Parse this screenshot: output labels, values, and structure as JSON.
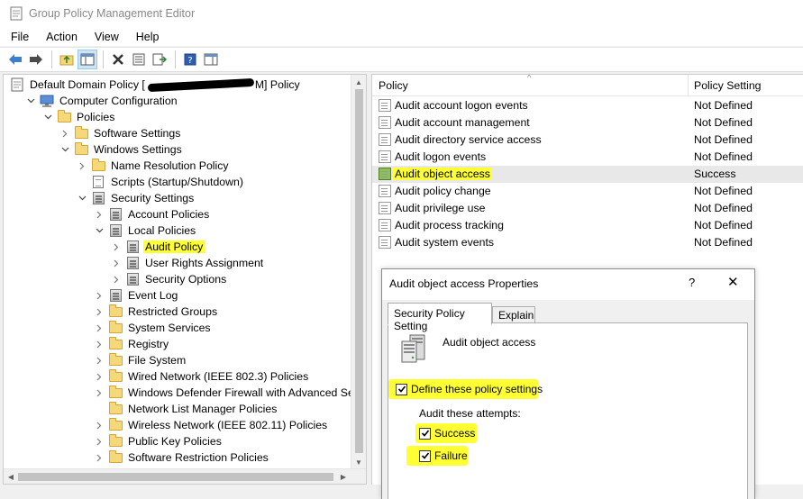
{
  "window": {
    "title": "Group Policy Management Editor"
  },
  "menu": [
    "File",
    "Action",
    "View",
    "Help"
  ],
  "tree": [
    {
      "label": "Default Domain Policy [",
      "suffix": "M] Policy",
      "indent": 0,
      "icon": "gpo-doc-icon",
      "arrow": "none",
      "highlight": false
    },
    {
      "label": "Computer Configuration",
      "indent": 1,
      "icon": "computer-icon",
      "arrow": "expanded",
      "highlight": false
    },
    {
      "label": "Policies",
      "indent": 2,
      "icon": "folder-icon",
      "arrow": "expanded",
      "highlight": false
    },
    {
      "label": "Software Settings",
      "indent": 3,
      "icon": "folder-icon",
      "arrow": "collapsed",
      "highlight": false
    },
    {
      "label": "Windows Settings",
      "indent": 3,
      "icon": "folder-icon",
      "arrow": "expanded",
      "highlight": false
    },
    {
      "label": "Name Resolution Policy",
      "indent": 4,
      "icon": "folder-icon",
      "arrow": "collapsed",
      "highlight": false
    },
    {
      "label": "Scripts (Startup/Shutdown)",
      "indent": 4,
      "icon": "doc-icon",
      "arrow": "none",
      "highlight": false
    },
    {
      "label": "Security Settings",
      "indent": 4,
      "icon": "security-icon",
      "arrow": "expanded",
      "highlight": false
    },
    {
      "label": "Account Policies",
      "indent": 5,
      "icon": "security-icon",
      "arrow": "collapsed",
      "highlight": false
    },
    {
      "label": "Local Policies",
      "indent": 5,
      "icon": "security-icon",
      "arrow": "expanded",
      "highlight": false
    },
    {
      "label": "Audit Policy",
      "indent": 6,
      "icon": "security-icon",
      "arrow": "collapsed",
      "highlight": true
    },
    {
      "label": "User Rights Assignment",
      "indent": 6,
      "icon": "security-icon",
      "arrow": "collapsed",
      "highlight": false
    },
    {
      "label": "Security Options",
      "indent": 6,
      "icon": "security-icon",
      "arrow": "collapsed",
      "highlight": false
    },
    {
      "label": "Event Log",
      "indent": 5,
      "icon": "security-icon",
      "arrow": "collapsed",
      "highlight": false
    },
    {
      "label": "Restricted Groups",
      "indent": 5,
      "icon": "folder-icon",
      "arrow": "collapsed",
      "highlight": false
    },
    {
      "label": "System Services",
      "indent": 5,
      "icon": "folder-icon",
      "arrow": "collapsed",
      "highlight": false
    },
    {
      "label": "Registry",
      "indent": 5,
      "icon": "folder-icon",
      "arrow": "collapsed",
      "highlight": false
    },
    {
      "label": "File System",
      "indent": 5,
      "icon": "folder-icon",
      "arrow": "collapsed",
      "highlight": false
    },
    {
      "label": "Wired Network (IEEE 802.3) Policies",
      "indent": 5,
      "icon": "folder-icon",
      "arrow": "collapsed",
      "highlight": false
    },
    {
      "label": "Windows Defender Firewall with Advanced Security",
      "indent": 5,
      "icon": "folder-icon",
      "arrow": "collapsed",
      "highlight": false
    },
    {
      "label": "Network List Manager Policies",
      "indent": 5,
      "icon": "folder-icon",
      "arrow": "none",
      "highlight": false
    },
    {
      "label": "Wireless Network (IEEE 802.11) Policies",
      "indent": 5,
      "icon": "folder-icon",
      "arrow": "collapsed",
      "highlight": false
    },
    {
      "label": "Public Key Policies",
      "indent": 5,
      "icon": "folder-icon",
      "arrow": "collapsed",
      "highlight": false
    },
    {
      "label": "Software Restriction Policies",
      "indent": 5,
      "icon": "folder-icon",
      "arrow": "collapsed",
      "highlight": false
    }
  ],
  "list": {
    "columns": [
      "Policy",
      "Policy Setting"
    ],
    "rows": [
      {
        "policy": "Audit account logon events",
        "setting": "Not Defined",
        "selected": false
      },
      {
        "policy": "Audit account management",
        "setting": "Not Defined",
        "selected": false
      },
      {
        "policy": "Audit directory service access",
        "setting": "Not Defined",
        "selected": false
      },
      {
        "policy": "Audit logon events",
        "setting": "Not Defined",
        "selected": false
      },
      {
        "policy": "Audit object access",
        "setting": "Success",
        "selected": true
      },
      {
        "policy": "Audit policy change",
        "setting": "Not Defined",
        "selected": false
      },
      {
        "policy": "Audit privilege use",
        "setting": "Not Defined",
        "selected": false
      },
      {
        "policy": "Audit process tracking",
        "setting": "Not Defined",
        "selected": false
      },
      {
        "policy": "Audit system events",
        "setting": "Not Defined",
        "selected": false
      }
    ]
  },
  "dialog": {
    "title": "Audit object access Properties",
    "help": "?",
    "close": "✕",
    "tabs": [
      "Security Policy Setting",
      "Explain"
    ],
    "policy_name": "Audit object access",
    "define_label": "Define these policy settings",
    "define_checked": true,
    "attempts_label": "Audit these attempts:",
    "success_label": "Success",
    "success_checked": true,
    "failure_label": "Failure",
    "failure_checked": true
  },
  "colors": {
    "highlight": "#ffff33",
    "selected_row": "#e8e8e8",
    "folder": "#f5d87a"
  }
}
